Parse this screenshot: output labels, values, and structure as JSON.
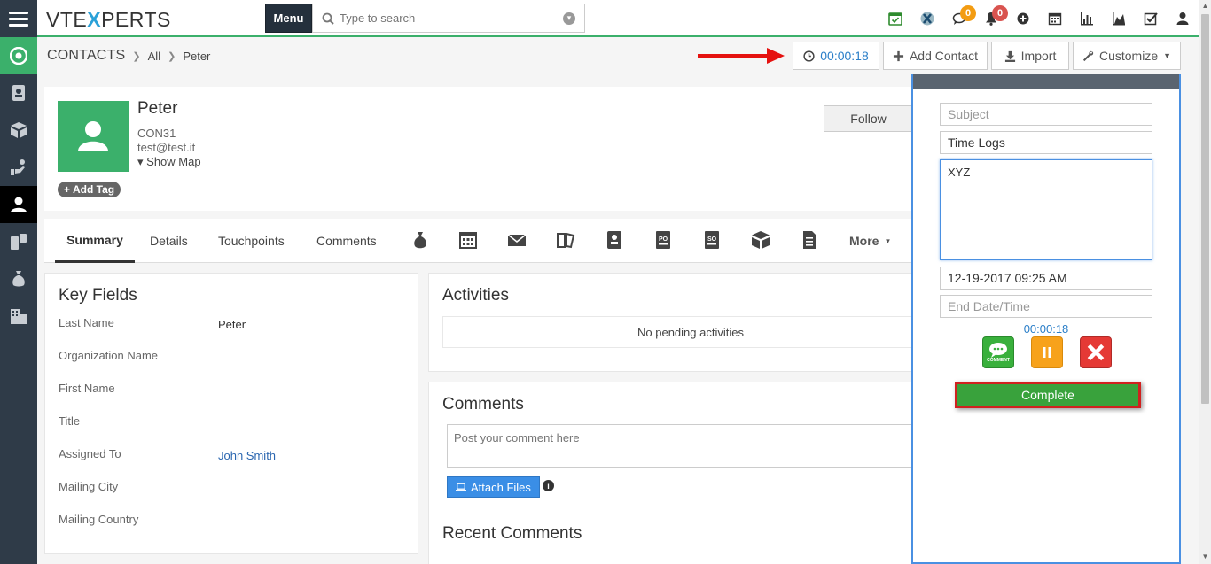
{
  "app": {
    "logo_left": "VTE",
    "logo_x": "X",
    "logo_right": "PERTS",
    "menu_label": "Menu"
  },
  "search": {
    "placeholder": "Type to search"
  },
  "top_icons": [
    {
      "name": "calendar-check-icon"
    },
    {
      "name": "vtexperts-icon"
    },
    {
      "name": "chat-icon",
      "badge": "0"
    },
    {
      "name": "bell-icon",
      "badge": "0"
    },
    {
      "name": "plus-circle-icon"
    },
    {
      "name": "calendar-icon"
    },
    {
      "name": "bar-chart-icon"
    },
    {
      "name": "area-chart-icon"
    },
    {
      "name": "checkbox-icon"
    },
    {
      "name": "user-icon"
    }
  ],
  "breadcrumb": {
    "module": "CONTACTS",
    "filter": "All",
    "record": "Peter"
  },
  "header_buttons": {
    "timer": "00:00:18",
    "add_contact": "Add Contact",
    "import": "Import",
    "customize": "Customize"
  },
  "profile": {
    "name": "Peter",
    "code": "CON31",
    "email": "test@test.it",
    "show_map": "Show Map",
    "add_tag": "Add Tag",
    "follow": "Follow"
  },
  "tabs": {
    "summary": "Summary",
    "details": "Details",
    "touchpoints": "Touchpoints",
    "comments": "Comments",
    "more": "More"
  },
  "key_fields": {
    "title": "Key Fields",
    "rows": [
      {
        "label": "Last Name",
        "value": "Peter"
      },
      {
        "label": "Organization Name",
        "value": ""
      },
      {
        "label": "First Name",
        "value": ""
      },
      {
        "label": "Title",
        "value": ""
      },
      {
        "label": "Assigned To",
        "value": "John Smith"
      },
      {
        "label": "Mailing City",
        "value": ""
      },
      {
        "label": "Mailing Country",
        "value": ""
      }
    ]
  },
  "activities": {
    "title": "Activities",
    "empty": "No pending activities"
  },
  "comments": {
    "title": "Comments",
    "placeholder": "Post your comment here",
    "attach": "Attach Files",
    "recent_title": "Recent Comments"
  },
  "time_log": {
    "subject_placeholder": "Subject",
    "module_value": "Time Logs",
    "description_value": "XYZ",
    "start_value": "12-19-2017 09:25 AM",
    "end_placeholder": "End Date/Time",
    "timer": "00:00:18",
    "comment_icon_text": "COMMENT",
    "complete": "Complete"
  }
}
